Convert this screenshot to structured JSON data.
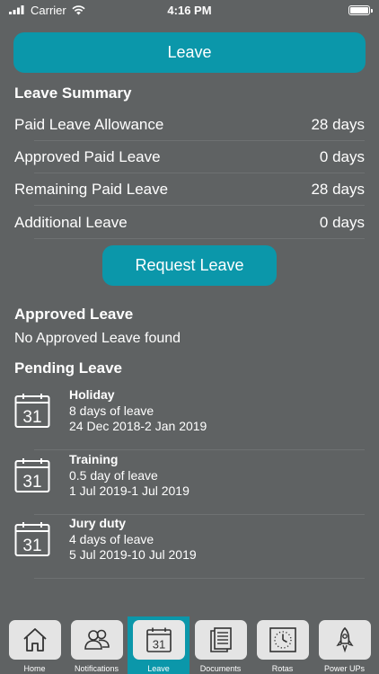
{
  "status_bar": {
    "carrier": "Carrier",
    "time": "4:16 PM"
  },
  "header": {
    "title": "Leave"
  },
  "summary": {
    "title": "Leave Summary",
    "rows": [
      {
        "label": "Paid Leave Allowance",
        "value": "28 days"
      },
      {
        "label": "Approved Paid Leave",
        "value": "0 days"
      },
      {
        "label": "Remaining Paid Leave",
        "value": "28 days"
      },
      {
        "label": "Additional Leave",
        "value": "0 days"
      }
    ]
  },
  "request_button": {
    "label": "Request Leave"
  },
  "approved": {
    "title": "Approved Leave",
    "empty_text": "No Approved Leave found"
  },
  "pending": {
    "title": "Pending Leave",
    "calendar_day": "31",
    "items": [
      {
        "type": "Holiday",
        "amount": "8 days of leave",
        "dates": "24 Dec 2018-2 Jan 2019"
      },
      {
        "type": "Training",
        "amount": "0.5 day of leave",
        "dates": "1 Jul 2019-1 Jul 2019"
      },
      {
        "type": "Jury duty",
        "amount": "4 days of leave",
        "dates": "5 Jul 2019-10 Jul 2019"
      }
    ]
  },
  "tabs": [
    {
      "label": "Home",
      "icon": "home-icon"
    },
    {
      "label": "Notifications",
      "icon": "people-icon"
    },
    {
      "label": "Leave",
      "icon": "calendar-icon",
      "active": true
    },
    {
      "label": "Documents",
      "icon": "document-icon"
    },
    {
      "label": "Rotas",
      "icon": "clock-icon"
    },
    {
      "label": "Power UPs",
      "icon": "rocket-icon"
    }
  ],
  "colors": {
    "accent": "#0b97aa",
    "background": "#5f6263",
    "tab_box": "#e4e4e4"
  }
}
